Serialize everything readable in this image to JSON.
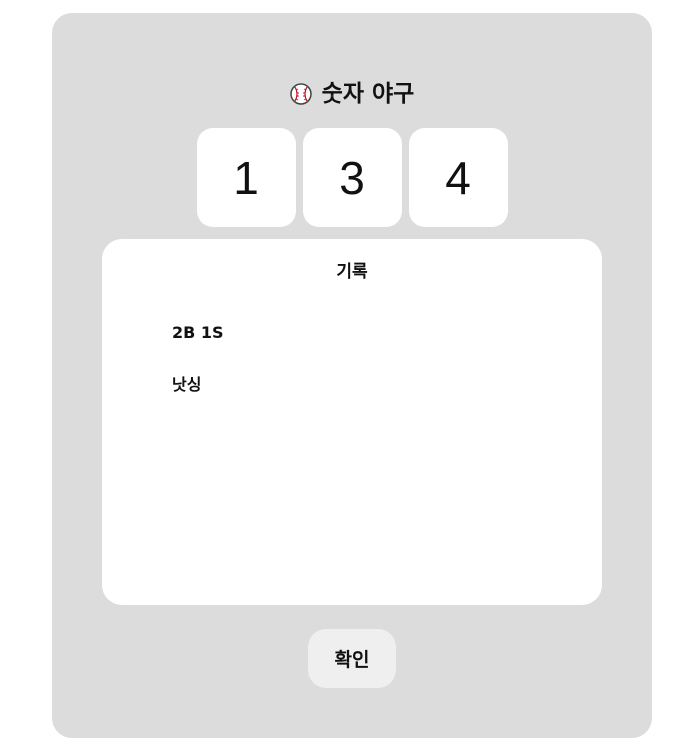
{
  "header": {
    "icon": "baseball-icon",
    "title": "숫자 야구"
  },
  "digits": [
    "1",
    "3",
    "4"
  ],
  "history": {
    "title": "기록",
    "items": [
      "2B 1S",
      "낫싱"
    ]
  },
  "confirm_button": {
    "label": "확인"
  },
  "colors": {
    "card_background": "#dcdcdc",
    "panel_background": "#ffffff",
    "button_background": "#efefef",
    "text": "#111111",
    "baseball_stitch": "#c8102e"
  }
}
